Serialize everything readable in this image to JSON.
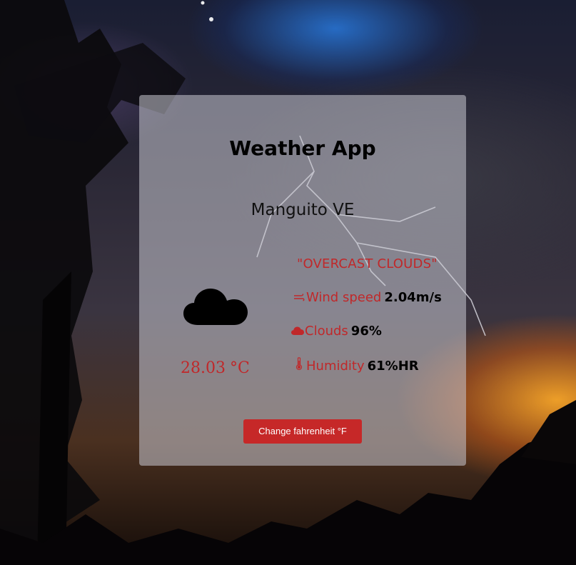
{
  "app": {
    "title": "Weather App"
  },
  "location": {
    "name": "Manguito VE"
  },
  "current": {
    "temperature_value": "28.03",
    "temperature_unit": "°C",
    "description": "\"OVERCAST CLOUDS\"",
    "weather_icon": "cloud-icon"
  },
  "details": {
    "wind": {
      "icon": "wind-icon",
      "label": "Wind speed",
      "value": "2.04m/s"
    },
    "clouds": {
      "icon": "cloud-small-icon",
      "label": "Clouds",
      "value": "96%"
    },
    "humidity": {
      "icon": "thermometer-icon",
      "label": "Humidity",
      "value": "61%HR"
    }
  },
  "actions": {
    "toggle_unit_label": "Change fahrenheit °F"
  },
  "colors": {
    "accent": "#c0282a",
    "button_bg": "#c62828",
    "card_bg": "rgba(200,200,210,0.55)"
  }
}
